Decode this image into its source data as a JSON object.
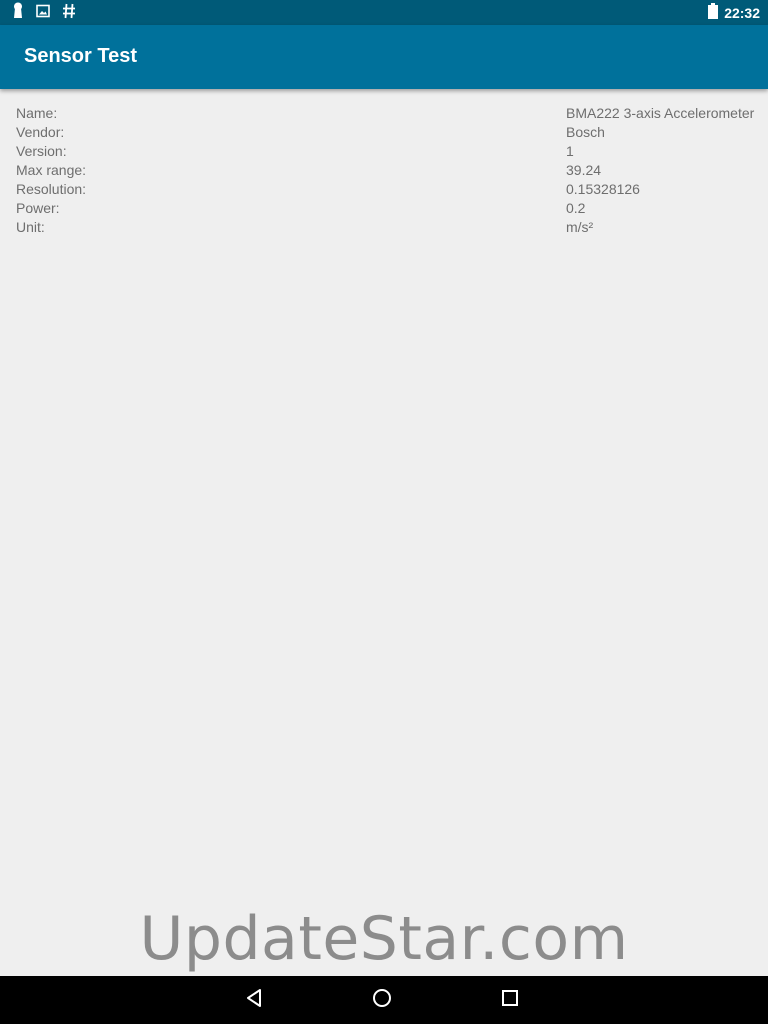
{
  "status_bar": {
    "time": "22:32",
    "left_icons": [
      "keyhole-icon",
      "image-icon",
      "hashtag-icon"
    ],
    "right_icons": [
      "battery-icon"
    ]
  },
  "app_bar": {
    "title": "Sensor Test",
    "color": "#00719b"
  },
  "sensor_info": [
    {
      "label": "Name:",
      "value": "BMA222 3-axis Accelerometer"
    },
    {
      "label": "Vendor:",
      "value": "Bosch"
    },
    {
      "label": "Version:",
      "value": "1"
    },
    {
      "label": "Max range:",
      "value": "39.24"
    },
    {
      "label": "Resolution:",
      "value": "0.15328126"
    },
    {
      "label": "Power:",
      "value": "0.2"
    },
    {
      "label": "Unit:",
      "value": "m/s²"
    }
  ],
  "watermark": "UpdateStar.com",
  "nav_bar": {
    "buttons": [
      "back-icon",
      "home-icon",
      "recents-icon"
    ]
  }
}
